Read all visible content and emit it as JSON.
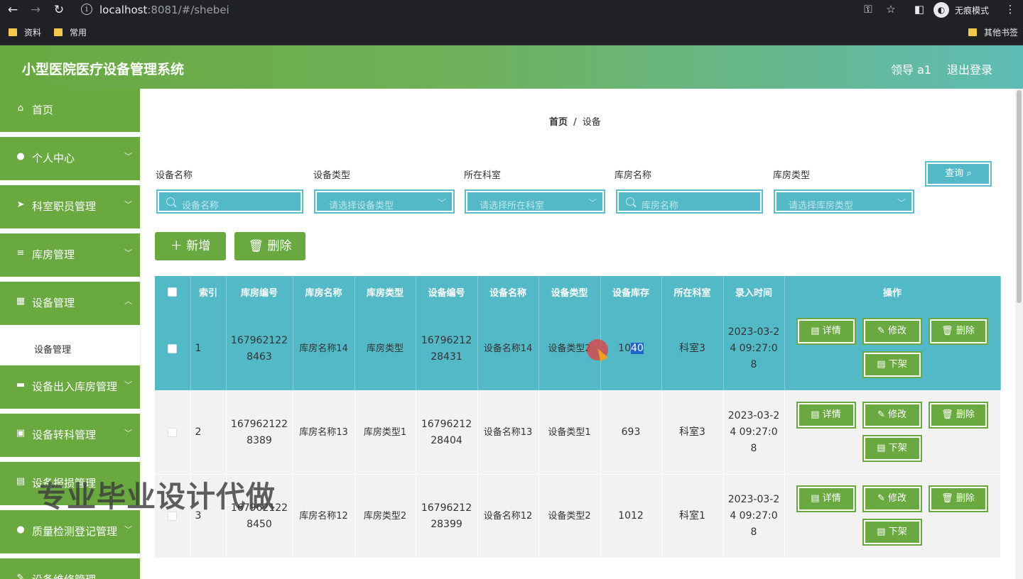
{
  "browser": {
    "url_host": "localhost",
    "url_rest": ":8081/#/shebei",
    "incognito_label": "无痕模式",
    "bookmarks": [
      "资料",
      "常用"
    ],
    "other_bookmarks": "其他书签"
  },
  "header": {
    "title": "小型医院医疗设备管理系统",
    "user": "领导 a1",
    "logout": "退出登录"
  },
  "sidebar": {
    "items": [
      {
        "label": "首页",
        "icon": "home-icon"
      },
      {
        "label": "个人中心",
        "icon": "person-icon"
      },
      {
        "label": "科室职员管理",
        "icon": "send-icon"
      },
      {
        "label": "库房管理",
        "icon": "menu-icon"
      },
      {
        "label": "设备管理",
        "icon": "grid-icon"
      },
      {
        "label": "设备出入库房管理",
        "icon": "box-icon"
      },
      {
        "label": "设备转科管理",
        "icon": "clipboard-icon"
      },
      {
        "label": "设备报损管理",
        "icon": "doc-icon"
      },
      {
        "label": "质量检测登记管理",
        "icon": "person-icon"
      },
      {
        "label": "设备维修管理",
        "icon": "tool-icon"
      }
    ],
    "sub_item": "设备管理"
  },
  "breadcrumb": {
    "home": "首页",
    "sep": "/",
    "current": "设备"
  },
  "filters": {
    "device_name_label": "设备名称",
    "device_name_placeholder": "设备名称",
    "device_type_label": "设备类型",
    "device_type_placeholder": "请选择设备类型",
    "department_label": "所在科室",
    "department_placeholder": "请选择所在科室",
    "warehouse_name_label": "库房名称",
    "warehouse_name_placeholder": "库房名称",
    "warehouse_type_label": "库房类型",
    "warehouse_type_placeholder": "请选择库房类型",
    "query": "查询"
  },
  "actions": {
    "add": "新增",
    "delete": "删除"
  },
  "table": {
    "columns": [
      "索引",
      "库房编号",
      "库房名称",
      "库房类型",
      "设备编号",
      "设备名称",
      "设备类型",
      "设备库存",
      "所在科室",
      "录入时间",
      "操作"
    ],
    "rows": [
      {
        "index": "1",
        "warehouse_no": "1679621228463",
        "warehouse_name": "库房名称14",
        "warehouse_type": "库房类型",
        "device_no": "1679621228431",
        "device_name": "设备名称14",
        "device_type": "设备类型2",
        "stock_a": "10",
        "stock_b": "40",
        "department": "科室3",
        "time": "2023-03-24 09:27:08"
      },
      {
        "index": "2",
        "warehouse_no": "1679621228389",
        "warehouse_name": "库房名称13",
        "warehouse_type": "库房类型1",
        "device_no": "1679621228404",
        "device_name": "设备名称13",
        "device_type": "设备类型1",
        "stock": "693",
        "department": "科室3",
        "time": "2023-03-24 09:27:08"
      },
      {
        "index": "3",
        "warehouse_no": "1679621228450",
        "warehouse_name": "库房名称12",
        "warehouse_type": "库房类型2",
        "device_no": "1679621228399",
        "device_name": "设备名称12",
        "device_type": "设备类型2",
        "stock": "1012",
        "department": "科室1",
        "time": "2023-03-24 09:27:08"
      }
    ],
    "ops": {
      "detail": "详情",
      "edit": "修改",
      "delete": "删除",
      "offshelf": "下架"
    }
  },
  "watermark": "专业毕业设计代做",
  "colors": {
    "green": "#6aa840",
    "teal": "#54b9c7"
  }
}
